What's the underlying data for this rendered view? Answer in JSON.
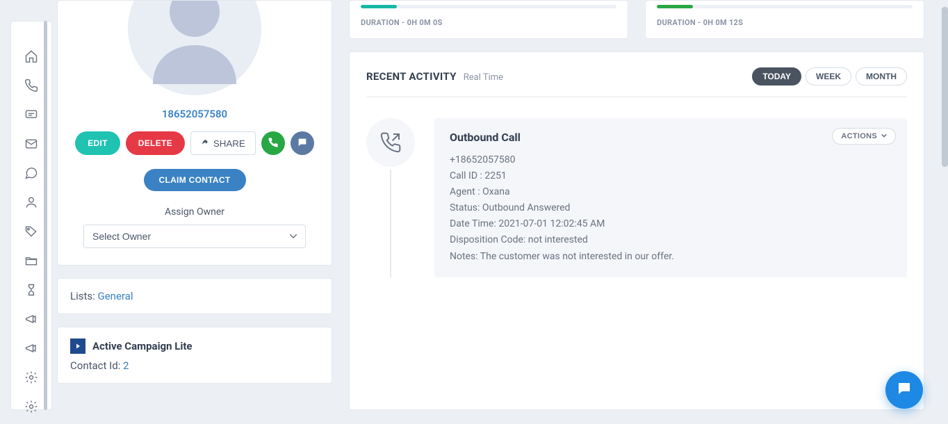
{
  "profile": {
    "phone": "18652057580",
    "edit_label": "EDIT",
    "delete_label": "DELETE",
    "share_label": "SHARE",
    "claim_label": "CLAIM CONTACT",
    "assign_owner_label": "Assign Owner",
    "select_owner_placeholder": "Select Owner"
  },
  "lists": {
    "label": "Lists: ",
    "value": "General"
  },
  "campaign": {
    "title": "Active Campaign Lite",
    "contact_id_label": "Contact Id: ",
    "contact_id_value": "2"
  },
  "stats": [
    {
      "duration_label": "DURATION - 0H 0M 0S",
      "fill_class": "stat-fill-teal"
    },
    {
      "duration_label": "DURATION - 0H 0M 12S",
      "fill_class": "stat-fill-green"
    }
  ],
  "activity": {
    "title": "RECENT ACTIVITY",
    "subtitle": "Real Time",
    "tabs": {
      "today": "TODAY",
      "week": "WEEK",
      "month": "MONTH"
    },
    "entry": {
      "title": "Outbound Call",
      "actions_label": "ACTIONS",
      "lines": {
        "phone": "+18652057580",
        "call_id": "Call ID : 2251",
        "agent": "Agent : Oxana",
        "status": "Status: Outbound Answered",
        "datetime": "Date Time: 2021-07-01 12:02:45 AM",
        "disposition": "Disposition Code: not interested",
        "notes": "Notes: The customer was not interested in our offer."
      }
    }
  }
}
